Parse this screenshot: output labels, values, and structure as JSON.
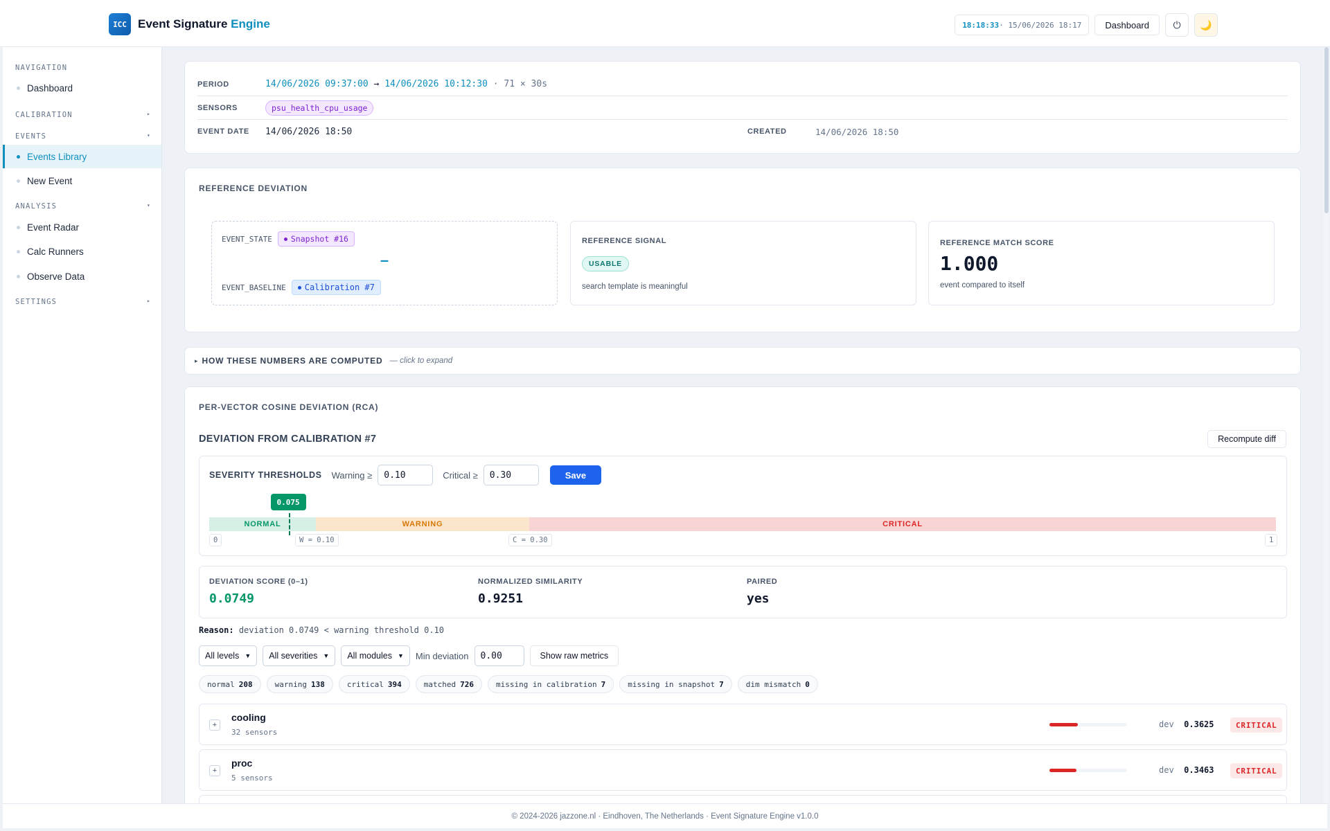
{
  "header": {
    "logo_text": "ICC",
    "title_main": "Event Signature ",
    "title_accent": "Engine",
    "clock_time": "18:18:33",
    "clock_rest": " · 15/06/2026 18:17",
    "dashboard_label": "Dashboard",
    "power_icon": "⏻",
    "moon_icon": "🌙"
  },
  "sidebar": {
    "sections": {
      "navigation": "NAVIGATION",
      "calibration": "CALIBRATION",
      "events": "EVENTS",
      "analysis": "ANALYSIS",
      "settings": "SETTINGS"
    },
    "items": {
      "dashboard": "Dashboard",
      "events_library": "Events Library",
      "new_event": "New Event",
      "event_radar": "Event Radar",
      "calc_runners": "Calc Runners",
      "observe_data": "Observe Data"
    },
    "collapsed_caret": "▸",
    "expanded_caret": "▾"
  },
  "meta": {
    "period_label": "PERIOD",
    "period_start": "14/06/2026 09:37:00",
    "period_arrow": " → ",
    "period_end": "14/06/2026 10:12:30",
    "period_extra": " · 71 × 30s",
    "sensors_label": "SENSORS",
    "sensor": "psu_health_cpu_usage",
    "event_date_label": "EVENT DATE",
    "event_date": "14/06/2026 18:50",
    "created_label": "CREATED",
    "created": "14/06/2026 18:50"
  },
  "reference": {
    "title": "REFERENCE DEVIATION",
    "event_state_label": "EVENT_STATE",
    "event_state_value": "Snapshot #16",
    "dash": "–",
    "event_baseline_label": "EVENT_BASELINE",
    "event_baseline_value": "Calibration #7",
    "signal_label": "REFERENCE SIGNAL",
    "signal_badge": "USABLE",
    "signal_note": "search template is meaningful",
    "score_label": "REFERENCE MATCH SCORE",
    "score_value": "1.000",
    "score_note": "event compared to itself"
  },
  "howto": {
    "arrow": "▸",
    "title": "HOW THESE NUMBERS ARE COMPUTED",
    "hint": "— click to expand"
  },
  "rca": {
    "title": "PER-VECTOR COSINE DEVIATION (RCA)",
    "subtitle": "DEVIATION FROM CALIBRATION #7",
    "recompute_label": "Recompute diff",
    "thresholds_label": "SEVERITY THRESHOLDS",
    "warning_label": "Warning ≥",
    "warning_value": "0.10",
    "critical_label": "Critical ≥",
    "critical_value": "0.30",
    "save_label": "Save",
    "band": {
      "marker_value": 0.075,
      "marker_label": "0.075",
      "normal": "NORMAL",
      "warning": "WARNING",
      "critical": "CRITICAL",
      "tick_min": "0",
      "tick_warn": "W = 0.10",
      "tick_crit": "C = 0.30",
      "tick_max": "1"
    },
    "stats": {
      "deviation_label": "DEVIATION SCORE (0–1)",
      "deviation_value": "0.0749",
      "similarity_label": "NORMALIZED SIMILARITY",
      "similarity_value": "0.9251",
      "paired_label": "PAIRED",
      "paired_value": "yes"
    },
    "reason_label": "Reason:",
    "reason_text": "deviation 0.0749 < warning threshold 0.10",
    "filters": {
      "levels": "All levels",
      "severities": "All severities",
      "modules": "All modules",
      "min_dev_label": "Min deviation",
      "min_dev_value": "0.00",
      "raw_metrics_label": "Show raw metrics"
    },
    "counts": [
      {
        "label": "normal",
        "value": "208"
      },
      {
        "label": "warning",
        "value": "138"
      },
      {
        "label": "critical",
        "value": "394"
      },
      {
        "label": "matched",
        "value": "726"
      },
      {
        "label": "missing in calibration",
        "value": "7"
      },
      {
        "label": "missing in snapshot",
        "value": "7"
      },
      {
        "label": "dim mismatch",
        "value": "0"
      }
    ],
    "modules": [
      {
        "name": "cooling",
        "sub": "32 sensors",
        "dev_label": "dev",
        "dev": "0.3625",
        "dev_fraction": 0.3625,
        "severity": "CRITICAL"
      },
      {
        "name": "proc",
        "sub": "5 sensors",
        "dev_label": "dev",
        "dev": "0.3463",
        "dev_fraction": 0.3463,
        "severity": "CRITICAL"
      }
    ]
  },
  "footer": {
    "text": "© 2024-2026 jazzone.nl · Eindhoven, The Netherlands · Event Signature Engine v1.0.0"
  },
  "colors": {
    "accent": "#0f8fbf",
    "primary_button": "#1d63ed",
    "normal": "#059669",
    "warning": "#d97706",
    "critical": "#dc2626"
  }
}
